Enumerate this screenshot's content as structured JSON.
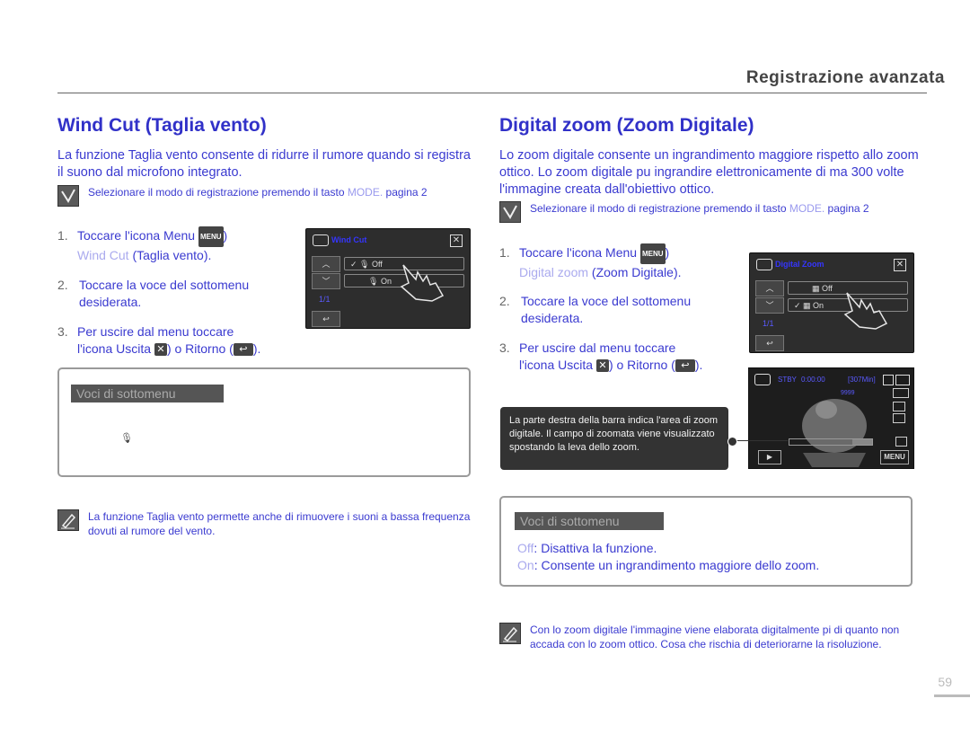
{
  "header": {
    "title": "Registrazione avanzata"
  },
  "left": {
    "title": "Wind Cut (Taglia vento)",
    "intro": "La funzione Taglia vento consente di ridurre il rumore quando si registra il suono dal microfono integrato.",
    "prereq": {
      "text": "Selezionare il modo di registrazione premendo il tasto",
      "mode": "MODE.",
      "page": "pagina 2"
    },
    "step1": {
      "num": "1.",
      "a": "Toccare l'icona Menu",
      "menu": "MENU",
      "b": ")",
      "sub_grey": "Wind Cut",
      "sub": "(Taglia vento)."
    },
    "step2": {
      "num": "2.",
      "text": "Toccare la voce del sottomenu desiderata."
    },
    "step3": {
      "num": "3.",
      "a": "Per uscire dal menu toccare",
      "b": "l'icona Uscita",
      "c": ") o Ritorno (",
      "d": ")."
    },
    "screen": {
      "title": "Wind Cut",
      "item_off": "Off",
      "item_on": "On",
      "page": "1/1"
    },
    "submenu": {
      "label": "Voci di sottomenu"
    },
    "note": "La funzione Taglia vento permette anche di rimuovere i suoni a bassa frequenza dovuti al rumore del vento."
  },
  "right": {
    "title": "Digital zoom (Zoom Digitale)",
    "intro": "Lo zoom digitale consente un ingrandimento maggiore rispetto allo zoom ottico. Lo zoom digitale pu ingrandire elettronicamente di ma 300 volte l'immagine creata dall'obiettivo ottico.",
    "prereq": {
      "text": "Selezionare il modo di registrazione premendo il tasto",
      "mode": "MODE.",
      "page": "pagina 2"
    },
    "step1": {
      "num": "1.",
      "a": "Toccare l'icona Menu",
      "menu": "MENU",
      "b": ")",
      "sub_grey": "Digital zoom",
      "sub": "(Zoom Digitale)."
    },
    "step2": {
      "num": "2.",
      "text": "Toccare la voce del sottomenu desiderata."
    },
    "step3": {
      "num": "3.",
      "a": "Per uscire dal menu toccare",
      "b": "l'icona Uscita",
      "c": ") o Ritorno (",
      "d": ")."
    },
    "screen": {
      "title": "Digital Zoom",
      "item_off": "Off",
      "item_on": "On",
      "page": "1/1"
    },
    "callout": "La parte destra della barra indica l'area di zoom digitale. Il campo di zoomata viene visualizzato spostando la leva dello zoom.",
    "camera": {
      "stby": "STBY",
      "time": "0:00:00",
      "remain": "[307Min]",
      "quality": "9999",
      "menu": "MENU"
    },
    "submenu": {
      "label": "Voci di sottomenu",
      "opt1_key": "Off",
      "opt1_text": "Disattiva la funzione.",
      "opt2_key": "On",
      "opt2_text": "Consente un ingrandimento maggiore dello zoom."
    },
    "note": "Con lo zoom digitale l'immagine viene elaborata digitalmente pi di quanto non accada con lo zoom ottico. Cosa che rischia di deteriorarne la risoluzione."
  },
  "page_number": "59"
}
